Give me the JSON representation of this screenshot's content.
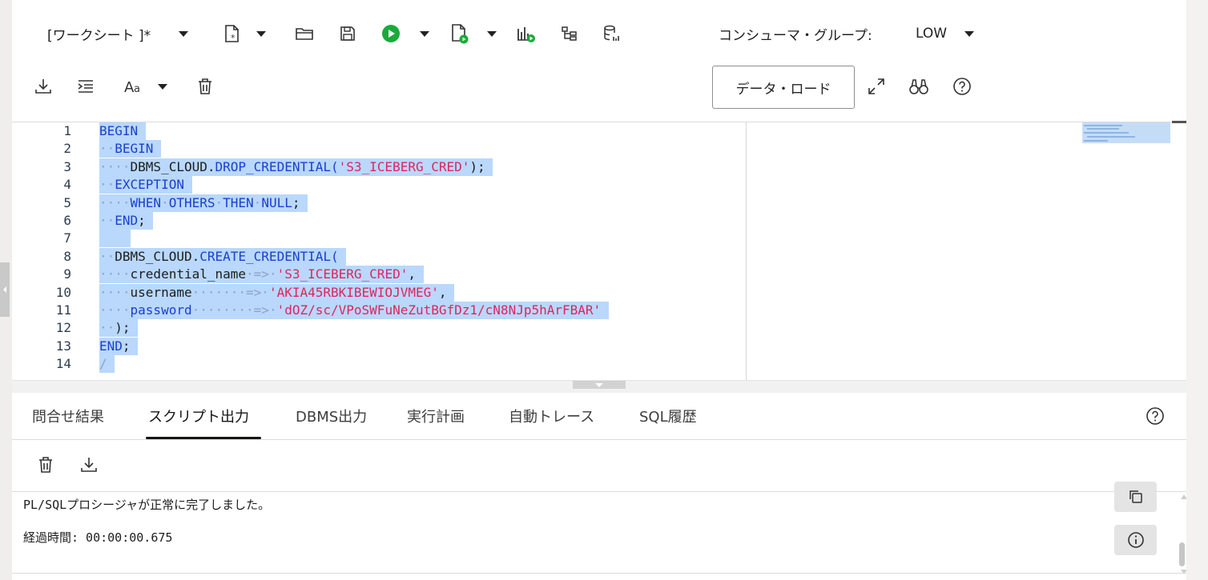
{
  "toolbar": {
    "worksheet_label": "[ワークシート ]*",
    "consumer_group_label": "コンシューマ・グループ:",
    "consumer_group_value": "LOW",
    "data_load_label": "データ・ロード"
  },
  "editor": {
    "line_numbers": [
      "1",
      "2",
      "3",
      "4",
      "5",
      "6",
      "7",
      "8",
      "9",
      "10",
      "11",
      "12",
      "13",
      "14"
    ],
    "lines": {
      "l1": {
        "kw": "BEGIN"
      },
      "l2": {
        "ws": "··",
        "kw": "BEGIN"
      },
      "l3": {
        "ws": "····",
        "plain": "DBMS_CLOUD.",
        "kw": "DROP_CREDENTIAL(",
        "str": "'S3_ICEBERG_CRED'",
        "pun": ");"
      },
      "l4": {
        "ws": "··",
        "kw": "EXCEPTION"
      },
      "l5": {
        "ws": "····",
        "kw1": "WHEN",
        "kw2": "OTHERS",
        "kw3": "THEN",
        "kw4": "NULL",
        "pun": ";"
      },
      "l6": {
        "ws": "··",
        "kw": "END",
        "pun": ";"
      },
      "l7": {
        "ws": ""
      },
      "l8": {
        "ws": "··",
        "plain": "DBMS_CLOUD.",
        "kw": "CREATE_CREDENTIAL("
      },
      "l9": {
        "ws": "····",
        "plain": "credential_name",
        "op": "=>",
        "str": "'S3_ICEBERG_CRED'",
        "pun": ","
      },
      "l10": {
        "ws": "····",
        "plain": "username",
        "dots": "·······",
        "op": "=>",
        "str": "'AKIA45RBKIBEWIOJVMEG'",
        "pun": ","
      },
      "l11": {
        "ws": "····",
        "kw": "password",
        "dots": "·······",
        "op": "=>",
        "str": "'dOZ/sc/VPoSWFuNeZutBGfDz1/cN8NJp5hArFBAR'"
      },
      "l12": {
        "ws": "··",
        "pun": ");"
      },
      "l13": {
        "kw": "END",
        "pun": ";"
      },
      "l14": {
        "op": "/"
      }
    }
  },
  "tabs": [
    "問合せ結果",
    "スクリプト出力",
    "DBMS出力",
    "実行計画",
    "自動トレース",
    "SQL履歴"
  ],
  "output": {
    "line1": "PL/SQLプロシージャが正常に完了しました。",
    "line2": "経過時間: 00:00:00.675"
  },
  "icons": [
    "caret-down-icon",
    "new-file-icon",
    "open-folder-icon",
    "save-icon",
    "run-icon",
    "run-script-icon",
    "explain-plan-icon",
    "autotrace-icon",
    "database-icon",
    "download-icon",
    "format-icon",
    "text-size-icon",
    "trash-icon",
    "expand-icon",
    "binoculars-icon",
    "help-icon",
    "copy-icon",
    "info-icon"
  ],
  "colors": {
    "keyword": "#1a3fcf",
    "string": "#e0245e",
    "selection": "#b9d8fc",
    "run_green": "#1aaa3a"
  }
}
